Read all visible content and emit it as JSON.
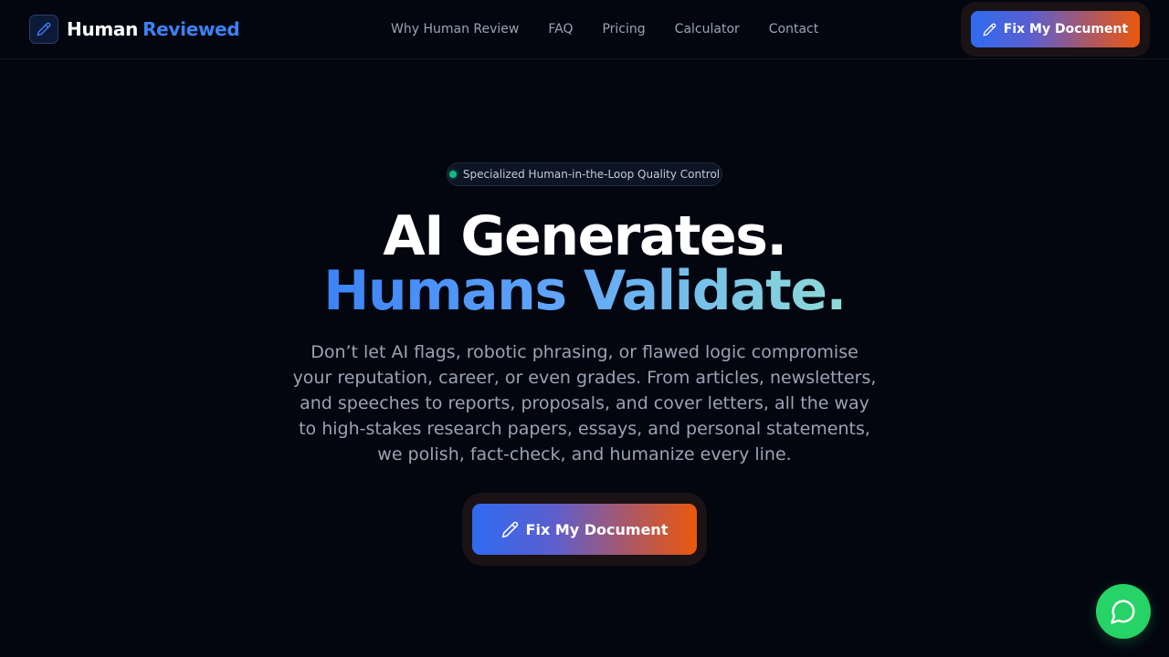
{
  "brand": {
    "name_part1": "Human",
    "name_part2": "Reviewed",
    "logo_icon": "pen-icon"
  },
  "nav": {
    "items": [
      {
        "label": "Why Human Review"
      },
      {
        "label": "FAQ"
      },
      {
        "label": "Pricing"
      },
      {
        "label": "Calculator"
      },
      {
        "label": "Contact"
      }
    ]
  },
  "header_cta": {
    "label": "Fix My Document",
    "icon": "pen-icon"
  },
  "hero": {
    "badge": "Specialized Human-in-the-Loop Quality Control",
    "headline_line1": "AI Generates.",
    "headline_line2": "Humans Validate.",
    "subtitle": "Don’t let AI flags, robotic phrasing, or flawed logic compromise your reputation, career, or even grades. From articles, newsletters, and speeches to reports, proposals, and cover letters, all the way to high-stakes research papers, essays, and personal statements, we polish, fact-check, and humanize every line.",
    "cta_label": "Fix My Document",
    "cta_icon": "pen-icon"
  },
  "chat_fab": {
    "icon": "chat-bubble-icon"
  },
  "colors": {
    "background": "#03060f",
    "accent_blue": "#3b82f6",
    "accent_orange": "#ea580c",
    "status_green": "#10b981",
    "chat_green": "#25d366"
  }
}
